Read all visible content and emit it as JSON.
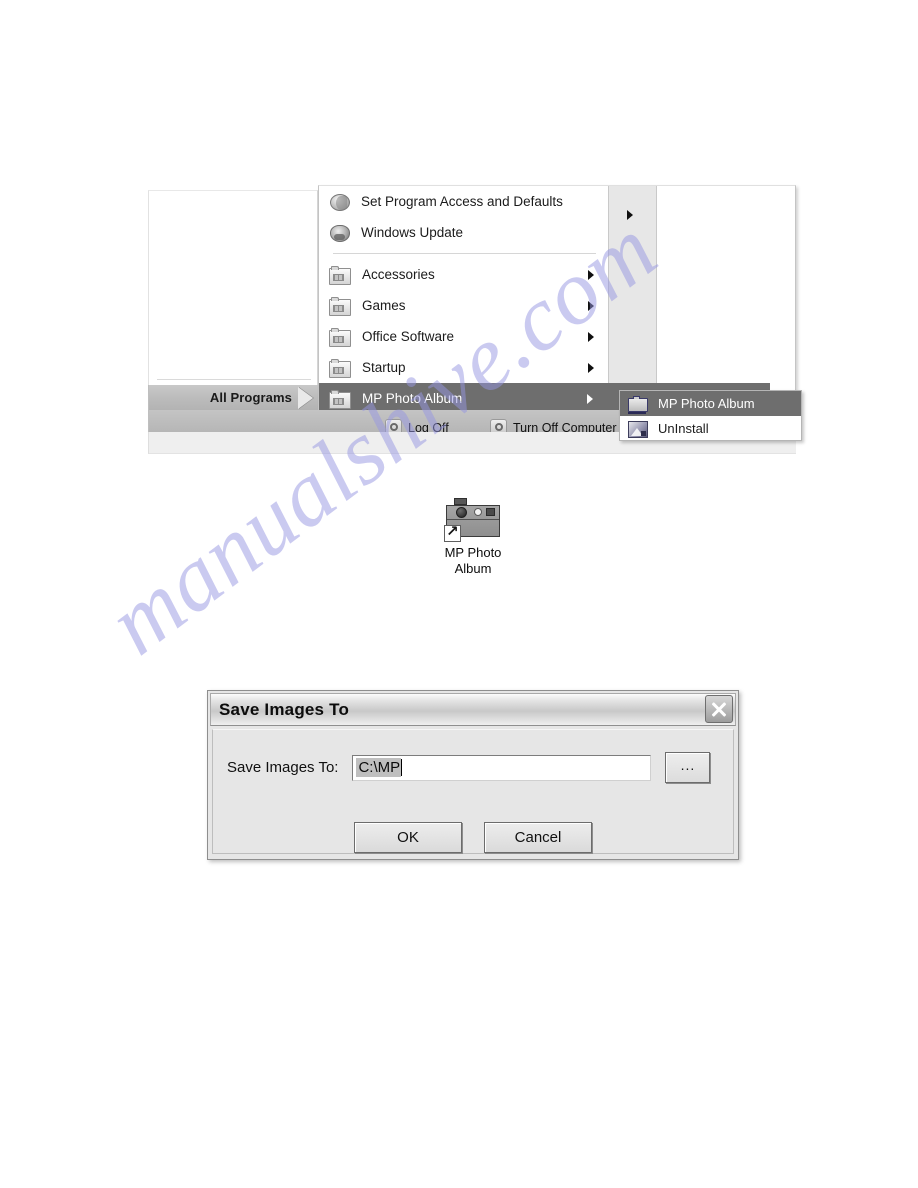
{
  "watermark": {
    "text": "manualshive.com"
  },
  "start_menu": {
    "all_programs_label": "All Programs",
    "programs": [
      {
        "label": "Set Program Access and Defaults",
        "icon": "globe-icon",
        "has_submenu": false,
        "selected": false
      },
      {
        "label": "Windows Update",
        "icon": "shield-icon",
        "has_submenu": false,
        "selected": false
      },
      {
        "label": "Accessories",
        "icon": "folder-icon",
        "has_submenu": true,
        "selected": false
      },
      {
        "label": "Games",
        "icon": "folder-icon",
        "has_submenu": true,
        "selected": false
      },
      {
        "label": "Office Software",
        "icon": "folder-icon",
        "has_submenu": true,
        "selected": false
      },
      {
        "label": "Startup",
        "icon": "folder-icon",
        "has_submenu": true,
        "selected": false
      },
      {
        "label": "MP Photo Album",
        "icon": "folder-icon",
        "has_submenu": true,
        "selected": true
      }
    ],
    "submenu": {
      "items": [
        {
          "label": "MP Photo Album",
          "icon": "camera-icon",
          "selected": true
        },
        {
          "label": "UnInstall",
          "icon": "uninstall-icon",
          "selected": false
        }
      ]
    },
    "footer": {
      "log_off_label": "Log Off",
      "turn_off_label": "Turn Off Computer"
    }
  },
  "desktop_shortcut": {
    "label_line1": "MP Photo",
    "label_line2": "Album",
    "icon": "camera-shortcut-icon"
  },
  "dialog": {
    "title": "Save Images To",
    "close_label": "",
    "field_label": "Save Images To:",
    "field_value": "C:\\MP",
    "field_placeholder": "",
    "browse_label": "...",
    "ok_label": "OK",
    "cancel_label": "Cancel"
  },
  "colors": {
    "menu_highlight": "#6e6e6e",
    "menu_bg": "#ffffff",
    "chrome_grey": "#bdbdbd",
    "dialog_face": "#e6e6e6",
    "watermark": "#9696e1"
  }
}
